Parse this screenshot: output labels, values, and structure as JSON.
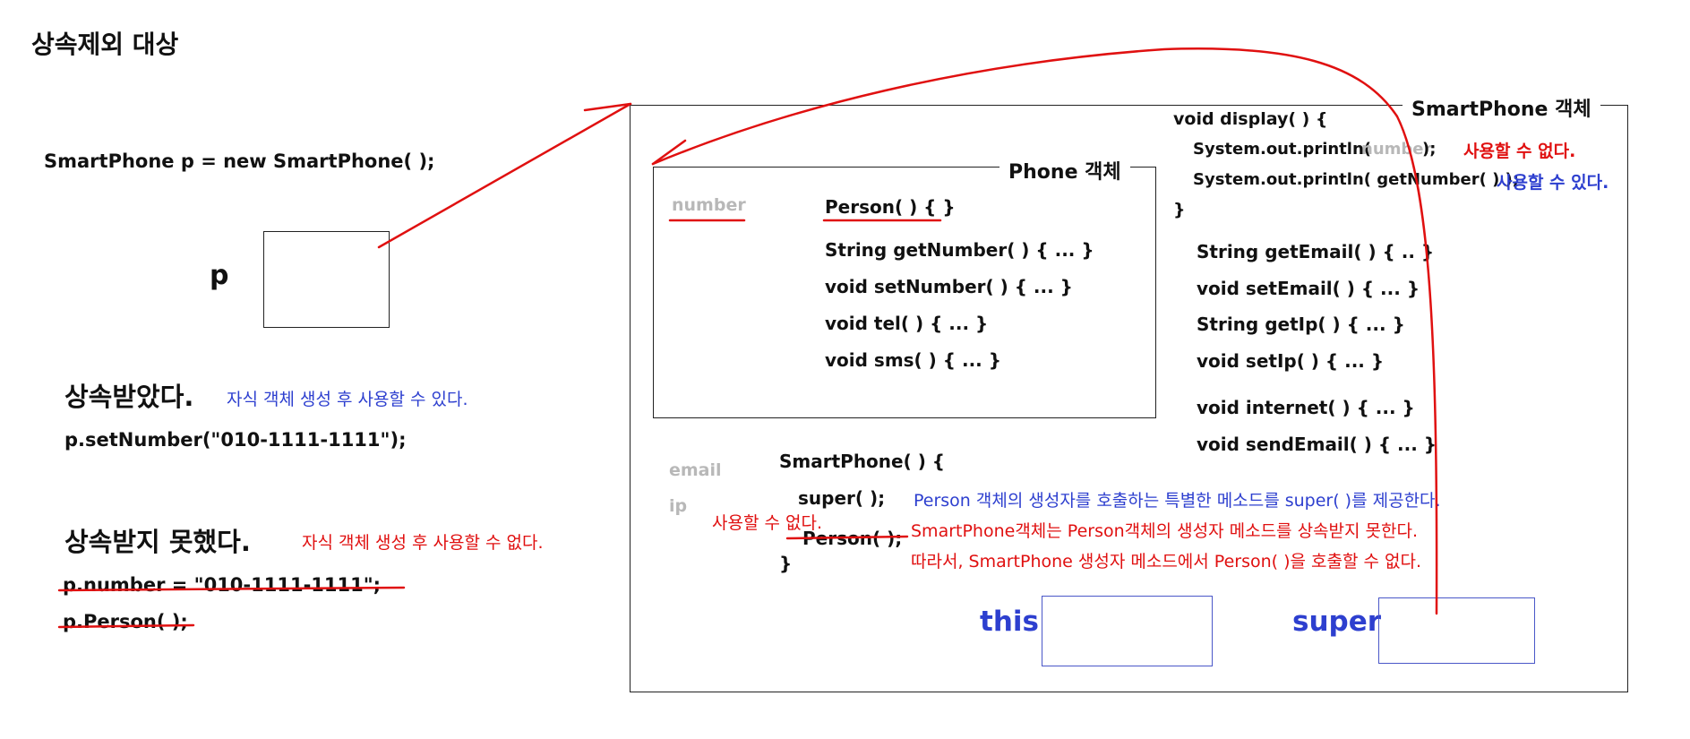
{
  "title": "상속제외 대상",
  "declaration": "SmartPhone p = new SmartPhone( );",
  "var_label": "p",
  "inherited": {
    "heading": "상속받았다.",
    "note": "자식 객체 생성 후 사용할 수 있다.",
    "code": "p.setNumber(\"010-1111-1111\");"
  },
  "not_inherited": {
    "heading": "상속받지 못했다.",
    "note": "자식 객체 생성 후 사용할 수 없다.",
    "code_1": "p.number = \"010-1111-1111\";",
    "code_2": "p.Person( );"
  },
  "smartphone": {
    "label": "SmartPhone 객체",
    "display_method": {
      "open": "void display( ) {",
      "line1_prefix": "System.out.println(",
      "line1_field": "number",
      "line1_suffix": ");",
      "line1_note": "사용할 수 없다.",
      "line2": "System.out.println( getNumber( ) );",
      "line2_note": "사용할 수 있다.",
      "close": "}"
    },
    "methods": [
      "String getEmail( ) { .. }",
      "void setEmail( ) { ... }",
      "String getIp( ) { ... }",
      "void setIp( ) { ... }",
      "void internet( ) { ... }",
      "void sendEmail( ) { ... }"
    ],
    "fields": [
      "email",
      "ip"
    ],
    "constructor": {
      "open": "SmartPhone( ) {",
      "super_call": "super( );",
      "super_note": "Person 객체의 생성자를 호출하는 특별한 메소드를 super( )를 제공한다.",
      "cannot_use": "사용할 수 없다.",
      "person_call": "Person( );",
      "note_line1": "SmartPhone객체는 Person객체의 생성자 메소드를 상속받지 못한다.",
      "note_line2": "따라서, SmartPhone 생성자 메소드에서 Person( )을 호출할 수 없다.",
      "close": "}"
    },
    "this_label": "this",
    "super_label": "super"
  },
  "phone": {
    "label": "Phone 객체",
    "field": "number",
    "constructor": "Person( ) { }",
    "methods": [
      "String getNumber( ) { ... }",
      "void setNumber( ) { ... }",
      "void tel( ) { ... }",
      "void sms( ) { ... }"
    ]
  },
  "colors": {
    "annotation_red": "#e01010",
    "annotation_blue": "#2d3fcf",
    "field_gray": "#b8b8b8"
  }
}
